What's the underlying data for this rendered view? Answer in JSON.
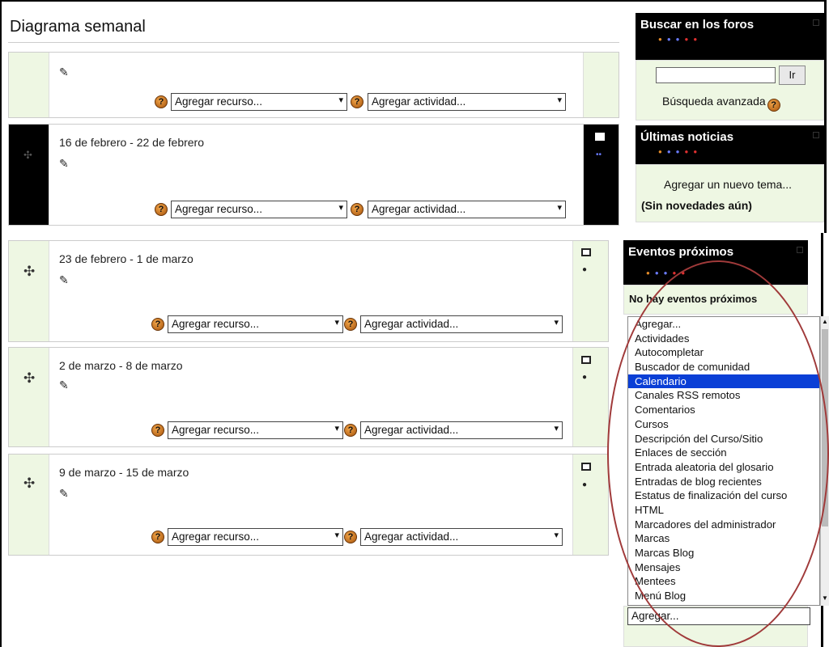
{
  "title": "Diagrama semanal",
  "sections": [
    {
      "title": "",
      "add_resource": "Agregar recurso...",
      "add_activity": "Agregar actividad..."
    },
    {
      "title": "16 de febrero - 22 de febrero",
      "add_resource": "Agregar recurso...",
      "add_activity": "Agregar actividad..."
    },
    {
      "title": "23 de febrero - 1 de marzo",
      "add_resource": "Agregar recurso...",
      "add_activity": "Agregar actividad..."
    },
    {
      "title": "2 de marzo - 8 de marzo",
      "add_resource": "Agregar recurso...",
      "add_activity": "Agregar actividad..."
    },
    {
      "title": "9 de marzo - 15 de marzo",
      "add_resource": "Agregar recurso...",
      "add_activity": "Agregar actividad..."
    }
  ],
  "search_block": {
    "title": "Buscar en los foros",
    "button": "Ir",
    "advanced": "Búsqueda avanzada"
  },
  "news_block": {
    "title": "Últimas noticias",
    "add_topic": "Agregar un nuevo tema...",
    "empty": "(Sin novedades aún)"
  },
  "events_block": {
    "title": "Eventos próximos",
    "empty": "No hay eventos próximos"
  },
  "add_block": {
    "selected_value": "Agregar...",
    "options": [
      "Agregar...",
      "Actividades",
      "Autocompletar",
      "Buscador de comunidad",
      "Calendario",
      "Canales RSS remotos",
      "Comentarios",
      "Cursos",
      "Descripción del Curso/Sitio",
      "Enlaces de sección",
      "Entrada aleatoria del glosario",
      "Entradas de blog recientes",
      "Estatus de finalización del curso",
      "HTML",
      "Marcadores del administrador",
      "Marcas",
      "Marcas Blog",
      "Mensajes",
      "Mentees",
      "Menú Blog"
    ],
    "highlighted": "Calendario"
  },
  "colors": {
    "accent": "#eef7e3",
    "highlight": "#0a3fd6",
    "annotation": "#a03a3a"
  }
}
